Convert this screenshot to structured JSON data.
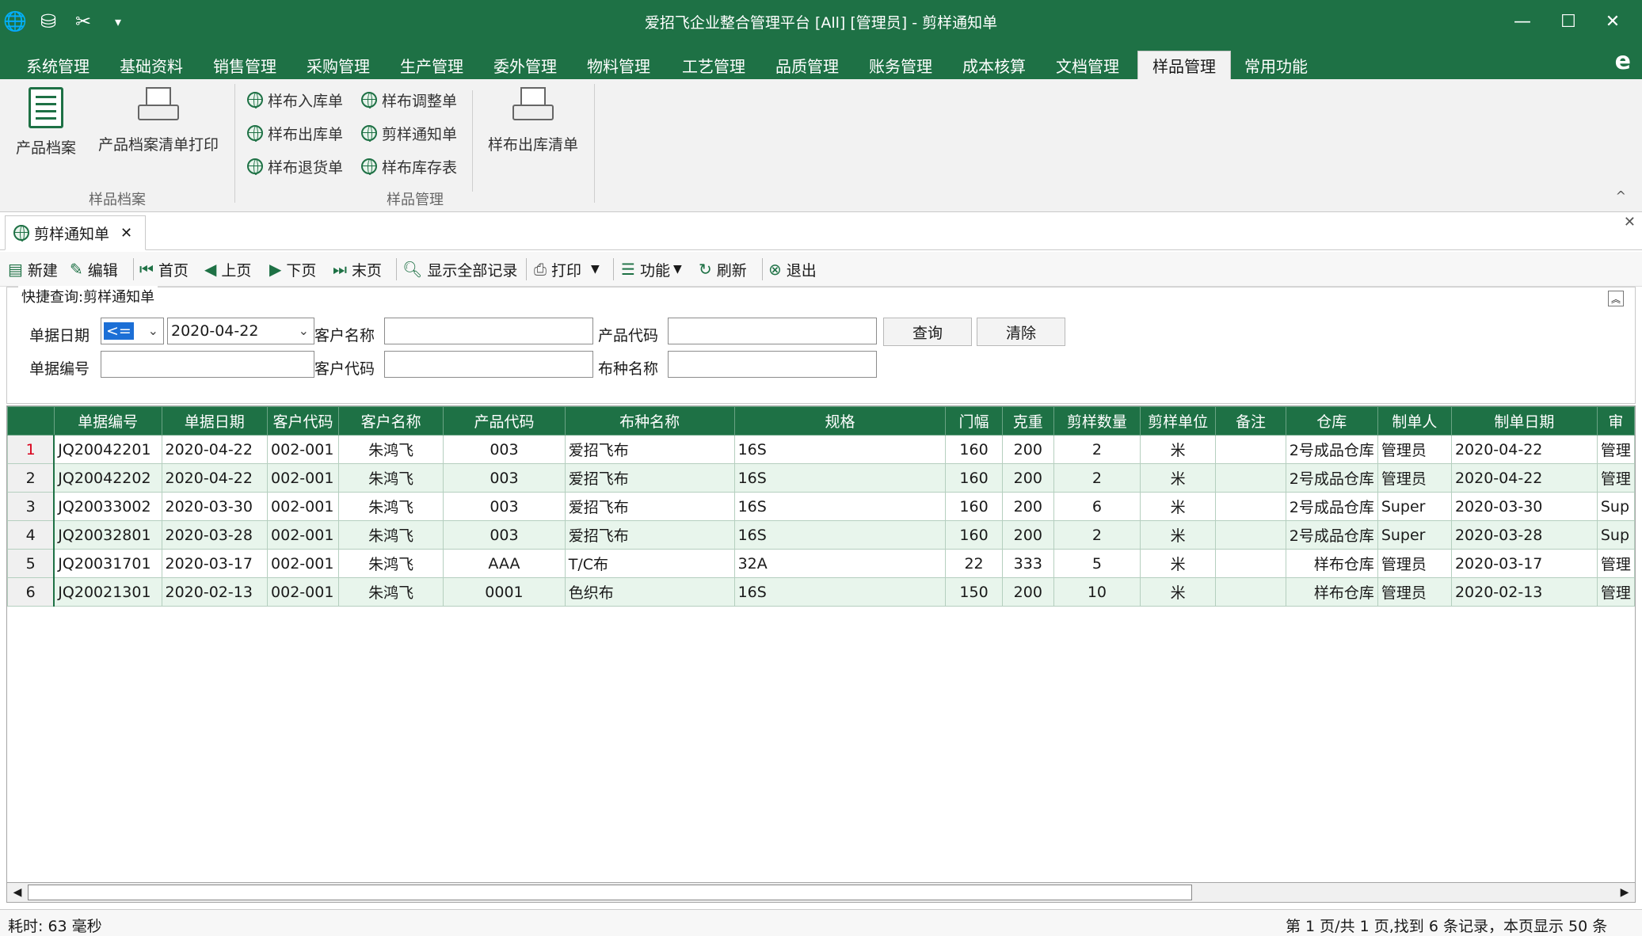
{
  "window": {
    "title": "爱招飞企业整合管理平台 [All] [管理员] - 剪样通知单",
    "quick_access_icons": [
      "globe-icon",
      "database-icon",
      "tools-icon",
      "customize-icon"
    ],
    "controls": {
      "minimize": "—",
      "maximize": "☐",
      "close": "✕"
    }
  },
  "menu": {
    "tabs": [
      "系统管理",
      "基础资料",
      "销售管理",
      "采购管理",
      "生产管理",
      "委外管理",
      "物料管理",
      "工艺管理",
      "品质管理",
      "账务管理",
      "成本核算",
      "文档管理",
      "样品管理",
      "常用功能"
    ],
    "active": "样品管理",
    "help_icon": "e"
  },
  "ribbon": {
    "group1": {
      "label": "样品档案",
      "items": [
        "产品档案",
        "产品档案清单打印"
      ]
    },
    "group2": {
      "label": "样品管理",
      "col1": [
        "样布入库单",
        "样布出库单",
        "样布退货单"
      ],
      "col2": [
        "样布调整单",
        "剪样通知单",
        "样布库存表"
      ],
      "big": "样布出库清单"
    },
    "collapse_glyph": "^"
  },
  "doc_tab": {
    "label": "剪样通知单",
    "close": "✕",
    "close_all": "✕"
  },
  "toolbar": {
    "new": "新建",
    "edit": "编辑",
    "first": "首页",
    "prev": "上页",
    "next": "下页",
    "last": "末页",
    "show_all": "显示全部记录",
    "print": "打印",
    "function": "功能",
    "refresh": "刷新",
    "exit": "退出"
  },
  "query": {
    "legend": "快捷查询:剪样通知单",
    "date_label": "单据日期",
    "date_op": "<=",
    "date_value": "2020-04-22",
    "customer_name_label": "客户名称",
    "customer_name_value": "",
    "product_code_label": "产品代码",
    "product_code_value": "",
    "doc_no_label": "单据编号",
    "doc_no_value": "",
    "customer_code_label": "客户代码",
    "customer_code_value": "",
    "fabric_name_label": "布种名称",
    "fabric_name_value": "",
    "search_btn": "查询",
    "clear_btn": "清除"
  },
  "grid": {
    "columns": [
      "单据编号",
      "单据日期",
      "客户代码",
      "客户名称",
      "产品代码",
      "布种名称",
      "规格",
      "门幅",
      "克重",
      "剪样数量",
      "剪样单位",
      "备注",
      "仓库",
      "制单人",
      "制单日期",
      "审"
    ],
    "rows": [
      {
        "n": "1",
        "no": "JQ20042201",
        "date": "2020-04-22",
        "cust_code": "002-001",
        "cust_name": "朱鸿飞",
        "prod": "003",
        "fabric": "爱招飞布",
        "spec": "16S",
        "width": "160",
        "weight": "200",
        "qty": "2",
        "unit": "米",
        "note": "",
        "wh": "2号成品仓库",
        "maker": "管理员",
        "mdate": "2020-04-22",
        "aud": "管理"
      },
      {
        "n": "2",
        "no": "JQ20042202",
        "date": "2020-04-22",
        "cust_code": "002-001",
        "cust_name": "朱鸿飞",
        "prod": "003",
        "fabric": "爱招飞布",
        "spec": "16S",
        "width": "160",
        "weight": "200",
        "qty": "2",
        "unit": "米",
        "note": "",
        "wh": "2号成品仓库",
        "maker": "管理员",
        "mdate": "2020-04-22",
        "aud": "管理"
      },
      {
        "n": "3",
        "no": "JQ20033002",
        "date": "2020-03-30",
        "cust_code": "002-001",
        "cust_name": "朱鸿飞",
        "prod": "003",
        "fabric": "爱招飞布",
        "spec": "16S",
        "width": "160",
        "weight": "200",
        "qty": "6",
        "unit": "米",
        "note": "",
        "wh": "2号成品仓库",
        "maker": "Super",
        "mdate": "2020-03-30",
        "aud": "Sup"
      },
      {
        "n": "4",
        "no": "JQ20032801",
        "date": "2020-03-28",
        "cust_code": "002-001",
        "cust_name": "朱鸿飞",
        "prod": "003",
        "fabric": "爱招飞布",
        "spec": "16S",
        "width": "160",
        "weight": "200",
        "qty": "2",
        "unit": "米",
        "note": "",
        "wh": "2号成品仓库",
        "maker": "Super",
        "mdate": "2020-03-28",
        "aud": "Sup"
      },
      {
        "n": "5",
        "no": "JQ20031701",
        "date": "2020-03-17",
        "cust_code": "002-001",
        "cust_name": "朱鸿飞",
        "prod": "AAA",
        "fabric": "T/C布",
        "spec": "32A",
        "width": "22",
        "weight": "333",
        "qty": "5",
        "unit": "米",
        "note": "",
        "wh": "样布仓库",
        "maker": "管理员",
        "mdate": "2020-03-17",
        "aud": "管理"
      },
      {
        "n": "6",
        "no": "JQ20021301",
        "date": "2020-02-13",
        "cust_code": "002-001",
        "cust_name": "朱鸿飞",
        "prod": "0001",
        "fabric": "色织布",
        "spec": "16S",
        "width": "150",
        "weight": "200",
        "qty": "10",
        "unit": "米",
        "note": "",
        "wh": "样布仓库",
        "maker": "管理员",
        "mdate": "2020-02-13",
        "aud": "管理"
      }
    ]
  },
  "status": {
    "elapsed": "耗时: 63 毫秒",
    "paging": "第 1 页/共 1 页,找到 6 条记录，本页显示 50 条"
  },
  "colors": {
    "brand": "#1e7145",
    "row_alt": "#e8f5ec",
    "current_row_num": "#d9001b"
  }
}
